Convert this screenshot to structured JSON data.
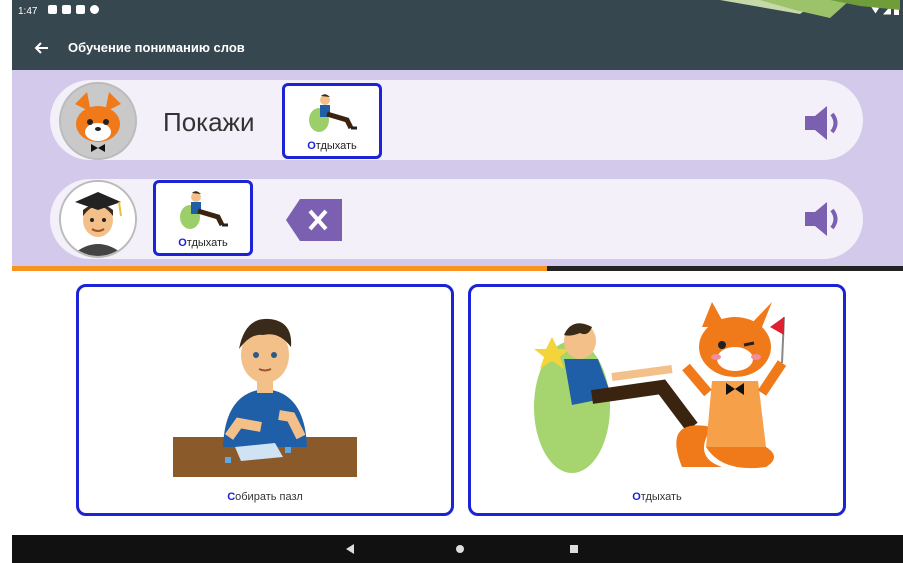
{
  "status_bar": {
    "time": "1:47"
  },
  "app_bar": {
    "title": "Обучение пониманию слов"
  },
  "prompt_row": {
    "text": "Покажи",
    "card": {
      "first_letter": "О",
      "rest": "тдыхать"
    }
  },
  "answer_row": {
    "card": {
      "first_letter": "О",
      "rest": "тдыхать"
    }
  },
  "progress": {
    "fraction": 0.6
  },
  "choices": [
    {
      "first_letter": "С",
      "rest": "обирать пазл"
    },
    {
      "first_letter": "О",
      "rest": "тдыхать"
    }
  ],
  "colors": {
    "accent_blue": "#1c22d6",
    "panel_purple": "#d3c9ea",
    "icon_purple": "#7b5fb0",
    "progress_orange": "#f7931e",
    "appbar": "#37474f"
  },
  "icons": {
    "back": "arrow-left-icon",
    "delete": "backspace-icon",
    "speaker": "speaker-icon",
    "nav_back": "triangle-back-icon",
    "nav_home": "circle-home-icon",
    "nav_recent": "square-recent-icon"
  }
}
